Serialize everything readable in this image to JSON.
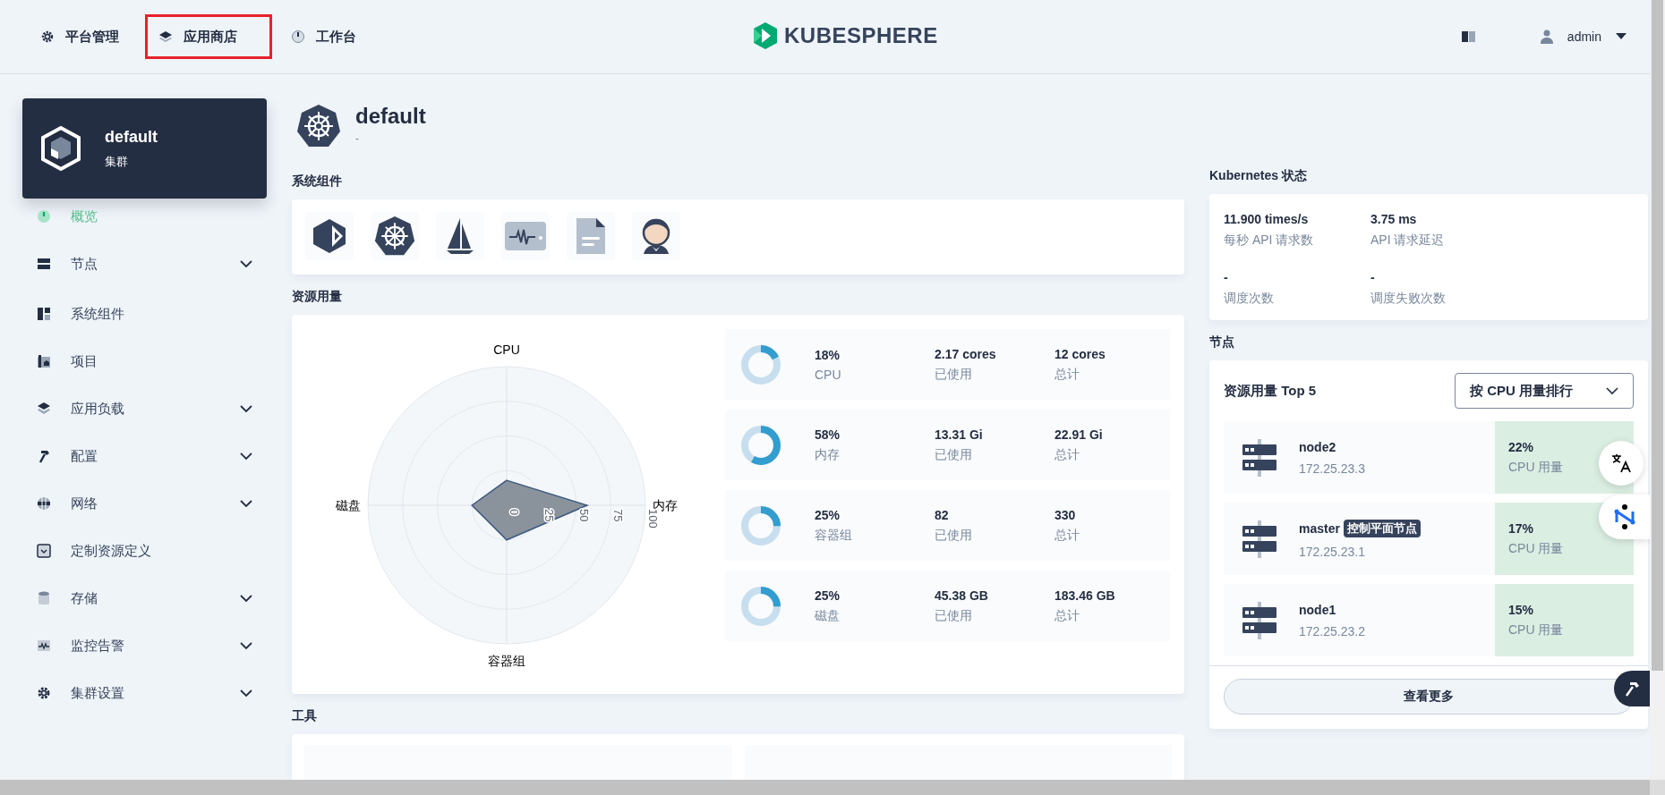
{
  "top_nav": [
    {
      "label": "平台管理",
      "highlighted": false
    },
    {
      "label": "应用商店",
      "highlighted": true
    },
    {
      "label": "工作台",
      "highlighted": false
    }
  ],
  "logo": {
    "text": "KUBESPHERE"
  },
  "user": {
    "name": "admin"
  },
  "cluster_card": {
    "name": "default",
    "type": "集群"
  },
  "sidebar": {
    "items": [
      {
        "label": "概览",
        "kind": "link",
        "selected": true
      },
      {
        "label": "节点",
        "kind": "group",
        "expanded": false,
        "selected": false
      },
      {
        "label": "系统组件",
        "kind": "link",
        "selected": false
      },
      {
        "label": "项目",
        "kind": "link",
        "selected": false
      },
      {
        "label": "应用负载",
        "kind": "group",
        "expanded": false,
        "selected": false
      },
      {
        "label": "配置",
        "kind": "group",
        "expanded": false,
        "selected": false
      },
      {
        "label": "网络",
        "kind": "group",
        "expanded": false,
        "selected": false
      },
      {
        "label": "定制资源定义",
        "kind": "link",
        "selected": false
      },
      {
        "label": "存储",
        "kind": "group",
        "expanded": false,
        "selected": false
      },
      {
        "label": "监控告警",
        "kind": "group",
        "expanded": false,
        "selected": false
      },
      {
        "label": "集群设置",
        "kind": "group",
        "expanded": false,
        "selected": false
      }
    ]
  },
  "header": {
    "title": "default",
    "description": "-"
  },
  "system_components": {
    "title": "系统组件"
  },
  "resource_usage": {
    "title": "资源用量",
    "radar": {
      "axes": [
        "CPU",
        "内存",
        "容器组",
        "磁盘"
      ],
      "ticks": [
        "0",
        "25",
        "50",
        "75",
        "100"
      ]
    },
    "stats": [
      {
        "percent": "18%",
        "level": 0.18,
        "name": "CPU",
        "used": "2.17 cores",
        "used_label": "已使用",
        "total": "12 cores",
        "total_label": "总计"
      },
      {
        "percent": "58%",
        "level": 0.58,
        "name": "内存",
        "used": "13.31 Gi",
        "used_label": "已使用",
        "total": "22.91 Gi",
        "total_label": "总计"
      },
      {
        "percent": "25%",
        "level": 0.25,
        "name": "容器组",
        "used": "82",
        "used_label": "已使用",
        "total": "330",
        "total_label": "总计"
      },
      {
        "percent": "25%",
        "level": 0.25,
        "name": "磁盘",
        "used": "45.38 GB",
        "used_label": "已使用",
        "total": "183.46 GB",
        "total_label": "总计"
      }
    ]
  },
  "tools": {
    "title": "工具"
  },
  "kubernetes_status": {
    "title": "Kubernetes 状态",
    "metrics": [
      {
        "value": "11.900 times/s",
        "label": "每秒 API 请求数"
      },
      {
        "value": "3.75 ms",
        "label": "API 请求延迟"
      },
      {
        "value": "-",
        "label": "调度次数"
      },
      {
        "value": "-",
        "label": "调度失败次数"
      }
    ]
  },
  "nodes": {
    "title": "节点",
    "subtitle": "资源用量 Top 5",
    "sort_select": "按 CPU 用量排行",
    "rows": [
      {
        "name": "node2",
        "ip": "172.25.23.3",
        "usage": "22%",
        "usage_label": "CPU 用量"
      },
      {
        "name": "master",
        "badge": "控制平面节点",
        "ip": "172.25.23.1",
        "usage": "17%",
        "usage_label": "CPU 用量"
      },
      {
        "name": "node1",
        "ip": "172.25.23.2",
        "usage": "15%",
        "usage_label": "CPU 用量"
      }
    ],
    "more_button": "查看更多"
  }
}
